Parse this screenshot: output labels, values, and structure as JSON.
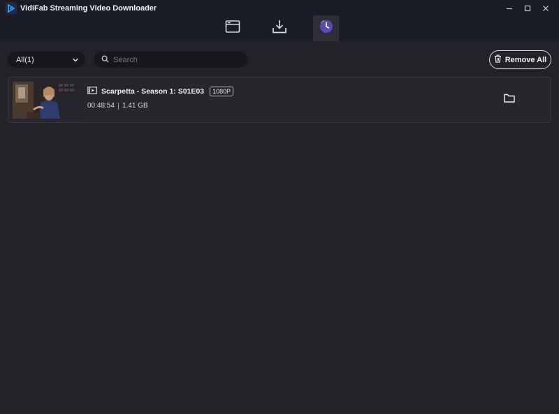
{
  "window": {
    "title": "VidiFab Streaming Video Downloader",
    "controls": [
      "minimize-icon",
      "maximize-icon",
      "close-icon"
    ]
  },
  "nav": {
    "tabs": [
      {
        "icon": "browser-icon",
        "active": false
      },
      {
        "icon": "download-icon",
        "active": false
      },
      {
        "icon": "history-icon",
        "active": true
      }
    ],
    "accent_color": "#5a4bb4"
  },
  "toolbar": {
    "filter": {
      "selected": "All(1)"
    },
    "search": {
      "placeholder": "Search",
      "value": ""
    },
    "remove_all_label": "Remove All"
  },
  "items": [
    {
      "title": "Scarpetta - Season 1: S01E03",
      "quality": "1080P",
      "duration": "00:48:54",
      "size": "1.41 GB",
      "type_icon": "video-file-icon",
      "action_icon": "folder-icon"
    }
  ]
}
